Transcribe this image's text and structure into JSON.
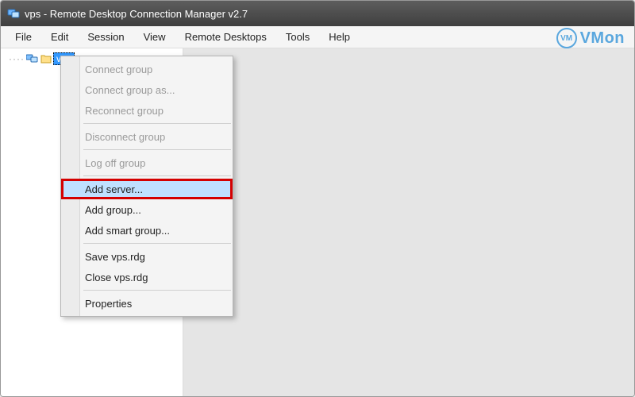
{
  "window": {
    "title": "vps - Remote Desktop Connection Manager v2.7"
  },
  "menubar": {
    "items": [
      "File",
      "Edit",
      "Session",
      "View",
      "Remote Desktops",
      "Tools",
      "Help"
    ]
  },
  "brand": {
    "badge": "VM",
    "name": "VMon"
  },
  "tree": {
    "root": {
      "label": "vps",
      "selected": true
    }
  },
  "context_menu": {
    "sections": [
      {
        "items": [
          {
            "label": "Connect group",
            "enabled": false
          },
          {
            "label": "Connect group as...",
            "enabled": false
          },
          {
            "label": "Reconnect group",
            "enabled": false
          }
        ]
      },
      {
        "items": [
          {
            "label": "Disconnect group",
            "enabled": false
          }
        ]
      },
      {
        "items": [
          {
            "label": "Log off group",
            "enabled": false
          }
        ]
      },
      {
        "items": [
          {
            "label": "Add server...",
            "enabled": true,
            "highlighted": true,
            "boxed": true
          },
          {
            "label": "Add group...",
            "enabled": true
          },
          {
            "label": "Add smart group...",
            "enabled": true
          }
        ]
      },
      {
        "items": [
          {
            "label": "Save vps.rdg",
            "enabled": true
          },
          {
            "label": "Close vps.rdg",
            "enabled": true
          }
        ]
      },
      {
        "items": [
          {
            "label": "Properties",
            "enabled": true
          }
        ]
      }
    ]
  }
}
